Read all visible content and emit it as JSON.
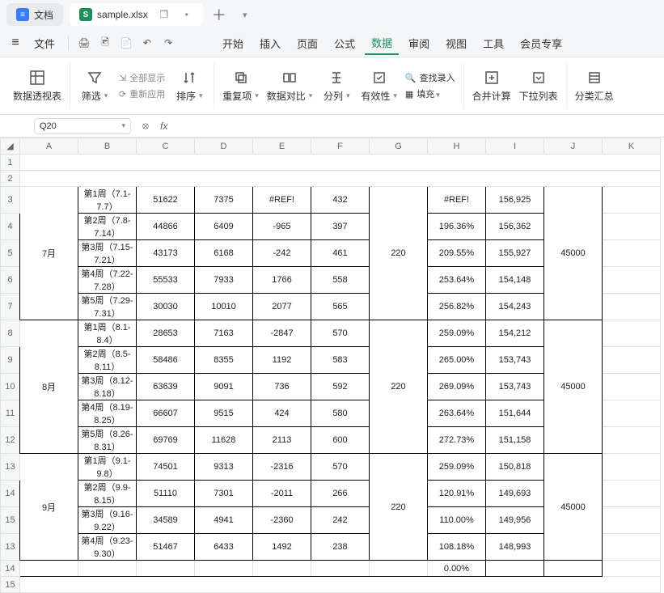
{
  "tabs": {
    "doc": "文档",
    "file": "sample.xlsx",
    "window_dup": "❐"
  },
  "menu": {
    "file": "文件",
    "items": [
      "开始",
      "插入",
      "页面",
      "公式",
      "数据",
      "审阅",
      "视图",
      "工具",
      "会员专享"
    ],
    "active_index": 4
  },
  "ribbon": {
    "pivot": "数据透视表",
    "filter": "筛选",
    "showall": "全部显示",
    "reapply": "重新应用",
    "sort": "排序",
    "dup": "重复项",
    "compare": "数据对比",
    "split": "分列",
    "validity": "有效性",
    "lookup": "查找录入",
    "fill": "填充",
    "merge": "合并计算",
    "dropdown": "下拉列表",
    "subtotal": "分类汇总"
  },
  "fx": {
    "cell": "Q20"
  },
  "cols": [
    "A",
    "B",
    "C",
    "D",
    "E",
    "F",
    "G",
    "H",
    "I",
    "J",
    "K"
  ],
  "rows": [
    "1",
    "2",
    "3",
    "4",
    "5",
    "6",
    "7",
    "8",
    "9",
    "10",
    "11",
    "12",
    "13",
    "14",
    "15"
  ],
  "data": {
    "r3": {
      "B": "第1周（7.1-7.7）",
      "C": "51622",
      "D": "7375",
      "E": "#REF!",
      "F": "432",
      "H": "#REF!",
      "I": "156,925"
    },
    "r4": {
      "B": "第2周（7.8-7.14）",
      "C": "44866",
      "D": "6409",
      "E": "-965",
      "F": "397",
      "H": "196.36%",
      "I": "156,362"
    },
    "r5": {
      "A": "7月",
      "B": "第3周（7.15-7.21）",
      "C": "43173",
      "D": "6168",
      "E": "-242",
      "F": "461",
      "G": "220",
      "H": "209.55%",
      "I": "155,927",
      "J": "45000"
    },
    "r6": {
      "B": "第4周（7.22-7.28）",
      "C": "55533",
      "D": "7933",
      "E": "1766",
      "F": "558",
      "H": "253.64%",
      "I": "154,148"
    },
    "r7": {
      "B": "第5周（7.29-7.31）",
      "C": "30030",
      "D": "10010",
      "E": "2077",
      "F": "565",
      "H": "256.82%",
      "I": "154,243"
    },
    "r8": {
      "B": "第1周（8.1-8.4）",
      "C": "28653",
      "D": "7163",
      "E": "-2847",
      "F": "570",
      "H": "259.09%",
      "I": "154,212"
    },
    "r9": {
      "B": "第2周（8.5-8.11）",
      "C": "58486",
      "D": "8355",
      "E": "1192",
      "F": "583",
      "H": "265.00%",
      "I": "153,743"
    },
    "r10": {
      "A": "8月",
      "B": "第3周（8.12-8.18）",
      "C": "63639",
      "D": "9091",
      "E": "736",
      "F": "592",
      "G": "220",
      "H": "269.09%",
      "I": "153,743",
      "J": "45000"
    },
    "r11": {
      "B": "第4周（8.19-8.25）",
      "C": "66607",
      "D": "9515",
      "E": "424",
      "F": "580",
      "H": "263.64%",
      "I": "151,644"
    },
    "r12": {
      "B": "第5周（8.26-8.31）",
      "C": "69769",
      "D": "11628",
      "E": "2113",
      "F": "600",
      "H": "272.73%",
      "I": "151,158"
    },
    "r13": {
      "B": "第1周（9.1-9.8）",
      "C": "74501",
      "D": "9313",
      "E": "-2316",
      "F": "570",
      "H": "259.09%",
      "I": "150,818"
    },
    "r14": {
      "B": "第2周（9.9-8.15）",
      "C": "51110",
      "D": "7301",
      "E": "-2011",
      "F": "266",
      "H": "120.91%",
      "I": "149,693"
    },
    "r15": {
      "A": "9月",
      "B": "第3周（9.16-9.22）",
      "C": "34589",
      "D": "4941",
      "E": "-2360",
      "F": "242",
      "G": "220",
      "H": "110.00%",
      "I": "149,956",
      "J": "45000"
    },
    "r16": {
      "B": "第4周（9.23-9.30）",
      "C": "51467",
      "D": "6433",
      "E": "1492",
      "F": "238",
      "H": "108.18%",
      "I": "148,993"
    },
    "r17": {
      "H": "0.00%"
    }
  }
}
